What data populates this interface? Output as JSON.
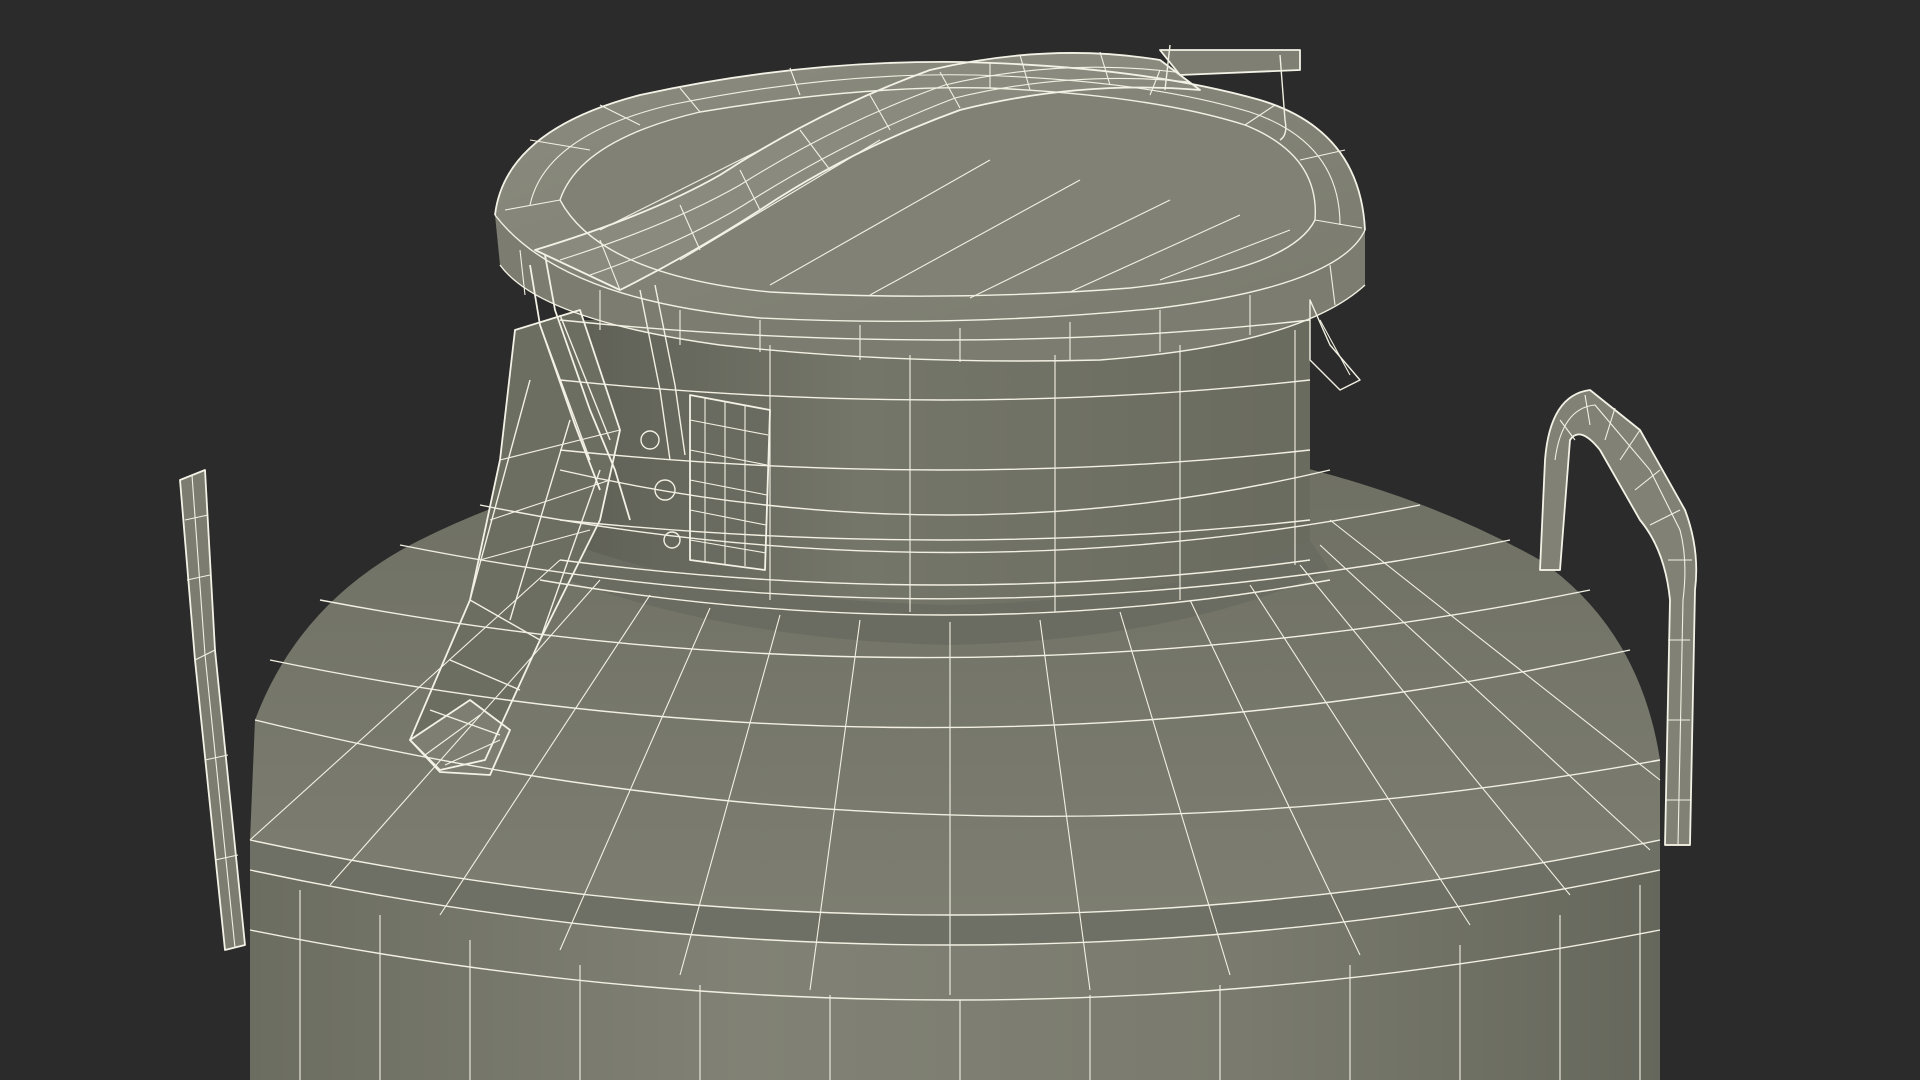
{
  "scene": {
    "subject": "milk-can-wireframe-render",
    "colors": {
      "background": "#2b2b2b",
      "surface": "#7a7b6e",
      "surface_dark": "#5f6056",
      "surface_light": "#8c8d80",
      "wire": "#f2f0e2"
    }
  }
}
